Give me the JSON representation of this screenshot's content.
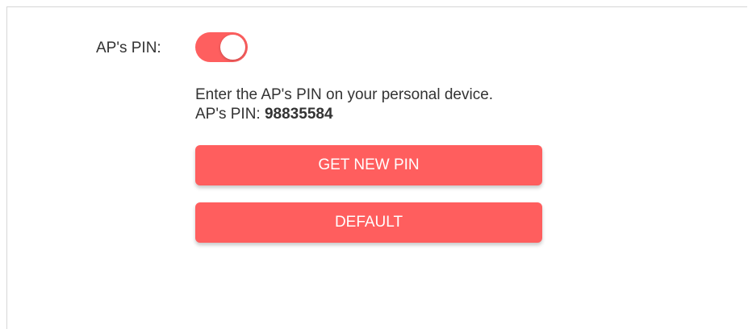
{
  "ap_pin": {
    "label": "AP's PIN:",
    "toggle_on": true,
    "description": "Enter the AP's PIN on your personal device.",
    "pin_prefix": "AP's PIN: ",
    "pin_value": "98835584"
  },
  "buttons": {
    "get_new_pin": "GET NEW PIN",
    "default": "DEFAULT"
  },
  "colors": {
    "accent": "#fe5f5f",
    "text": "#333333"
  }
}
